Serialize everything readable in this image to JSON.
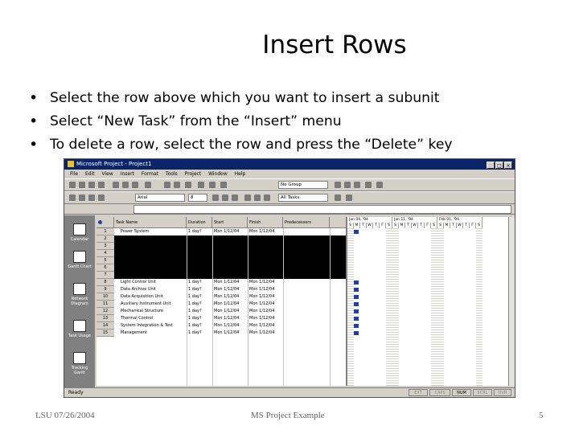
{
  "slide": {
    "title": "Insert Rows",
    "bullets": [
      "Select the row above which you want to insert a subunit",
      "Select “New Task” from the “Insert” menu",
      "To delete a row, select the row and press the “Delete” key"
    ],
    "bullet_symbol": "•",
    "footer": {
      "left": "LSU 07/26/2004",
      "center": "MS Project Example",
      "right": "5"
    }
  },
  "screenshot": {
    "window_title": "Microsoft Project - Project1",
    "window_buttons": [
      "_",
      "□",
      "×"
    ],
    "menu": [
      "File",
      "Edit",
      "View",
      "Insert",
      "Format",
      "Tools",
      "Project",
      "Window",
      "Help"
    ],
    "toolbar": {
      "group_value": "No Group",
      "font_value": "Arial",
      "size_value": "8",
      "filter_value": "All Tasks"
    },
    "view_bar": [
      "Calendar",
      "Gantt Chart",
      "Network Diagram",
      "Task Usage",
      "Tracking Gantt"
    ],
    "columns": [
      "Task Name",
      "Duration",
      "Start",
      "Finish",
      "Predecessors"
    ],
    "rows": [
      {
        "num": "1",
        "name": "Power System",
        "duration": "1 day?",
        "start": "Mon 1/12/04",
        "finish": "Mon 1/12/04",
        "selected": false
      },
      {
        "num": "2",
        "name": "",
        "duration": "",
        "start": "",
        "finish": "",
        "selected": true
      },
      {
        "num": "3",
        "name": "",
        "duration": "",
        "start": "",
        "finish": "",
        "selected": true
      },
      {
        "num": "4",
        "name": "",
        "duration": "",
        "start": "",
        "finish": "",
        "selected": true
      },
      {
        "num": "5",
        "name": "",
        "duration": "",
        "start": "",
        "finish": "",
        "selected": true
      },
      {
        "num": "6",
        "name": "",
        "duration": "",
        "start": "",
        "finish": "",
        "selected": true
      },
      {
        "num": "7",
        "name": "",
        "duration": "",
        "start": "",
        "finish": "",
        "selected": true
      },
      {
        "num": "8",
        "name": "Light Control Unit",
        "duration": "1 day?",
        "start": "Mon 1/12/04",
        "finish": "Mon 1/12/04",
        "selected": false
      },
      {
        "num": "9",
        "name": "Data Archive Unit",
        "duration": "1 day?",
        "start": "Mon 1/12/04",
        "finish": "Mon 1/12/04",
        "selected": false
      },
      {
        "num": "10",
        "name": "Data Acquisition Unit",
        "duration": "1 day?",
        "start": "Mon 1/12/04",
        "finish": "Mon 1/12/04",
        "selected": false
      },
      {
        "num": "11",
        "name": "Auxiliary Instrument Unit",
        "duration": "1 day?",
        "start": "Mon 1/12/04",
        "finish": "Mon 1/12/04",
        "selected": false
      },
      {
        "num": "12",
        "name": "Mechanical Structure",
        "duration": "1 day?",
        "start": "Mon 1/12/04",
        "finish": "Mon 1/12/04",
        "selected": false
      },
      {
        "num": "13",
        "name": "Thermal Control",
        "duration": "1 day?",
        "start": "Mon 1/12/04",
        "finish": "Mon 1/12/04",
        "selected": false
      },
      {
        "num": "14",
        "name": "System Integration & Test",
        "duration": "1 day?",
        "start": "Mon 1/12/04",
        "finish": "Mon 1/12/04",
        "selected": false
      },
      {
        "num": "15",
        "name": "Management",
        "duration": "1 day?",
        "start": "Mon 1/12/04",
        "finish": "Mon 1/12/04",
        "selected": false
      }
    ],
    "gantt_weeks": [
      "Jan 04, '04",
      "Jan 11, '04",
      "Feb 01, '04"
    ],
    "gantt_days": [
      "S",
      "M",
      "T",
      "W",
      "T",
      "F",
      "S",
      "S",
      "M",
      "T",
      "W",
      "T",
      "F",
      "S",
      "S",
      "M",
      "T",
      "W",
      "T",
      "F",
      "S"
    ],
    "status": {
      "ready": "Ready",
      "indicators": [
        "EXT",
        "CAPS",
        "NUM",
        "SCRL",
        "OVR"
      ]
    }
  }
}
